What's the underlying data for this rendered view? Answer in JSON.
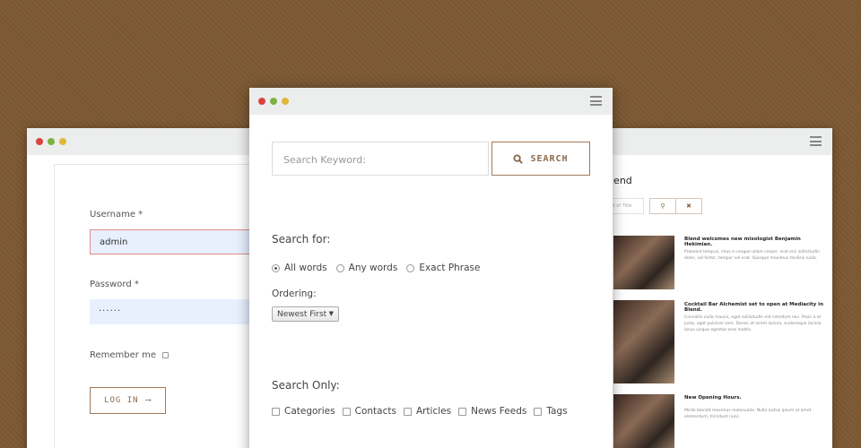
{
  "colors": {
    "dot_red": "#d9443f",
    "dot_green": "#7cb342",
    "dot_yellow": "#e0b83a",
    "accent": "#8b6a4c"
  },
  "login": {
    "username_label": "Username *",
    "username_value": "admin",
    "password_label": "Password *",
    "password_value": "······",
    "remember_label": "Remember me",
    "login_button": "LOG IN",
    "arrow": "⟶"
  },
  "search": {
    "keyword_placeholder": "Search Keyword:",
    "search_button": "SEARCH",
    "search_for_heading": "Search for:",
    "options": [
      {
        "label": "All words",
        "selected": true
      },
      {
        "label": "Any words",
        "selected": false
      },
      {
        "label": "Exact Phrase",
        "selected": false
      }
    ],
    "ordering_label": "Ordering:",
    "ordering_value": "Newest First",
    "search_only_heading": "Search Only:",
    "areas": [
      "Categories",
      "Contacts",
      "Articles",
      "News Feeds",
      "Tags"
    ]
  },
  "blog": {
    "title": "lend",
    "search_placeholder": "ct of Title",
    "posts": [
      {
        "title": "Blend welcomes new mixologist Benjamin Hekimian.",
        "text": "Praesent tempus, risus a congue ullam corper, erat orci sollicitudin dolor, vel fortor, tempor vel erat. Quisque maximus facilisis nulla."
      },
      {
        "title": "Cocktail Bar Alchemist set to open at Mediacity in Blend.",
        "text": "Convallis nulla mauris, eget sollicitudin elit interdum nec. Proin a et justo, eget pulvinar sem. Donec at lorem lacinia, scelerisque lacinia lacus uisque egestas eros mattis."
      },
      {
        "title": "New Opening Hours.",
        "text": "Morbi blandit maximus malesuada. Nulla luctus ipsum ut amet elementum, tincidunt nunc."
      }
    ]
  }
}
